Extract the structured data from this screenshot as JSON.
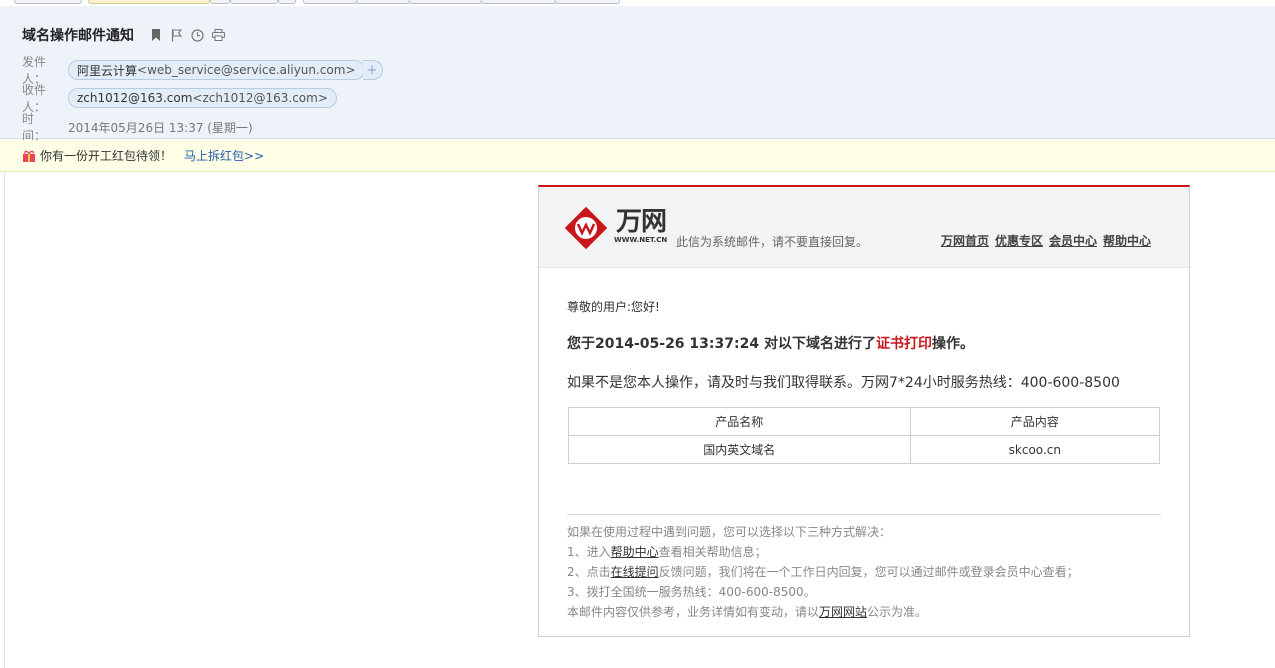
{
  "email": {
    "subject": "域名操作邮件通知",
    "from_label": "发件人：",
    "from_name": "阿里云计算",
    "from_addr": "<web_service@service.aliyun.com>",
    "add_contact": "+",
    "to_label": "收件人：",
    "to_name": "zch1012@163.com",
    "to_addr": "<zch1012@163.com>",
    "time_label": "时　间：",
    "time_value": "2014年05月26日 13:37 (星期一)"
  },
  "toolbar_icons": [
    "bookmark-icon",
    "flag-icon",
    "clock-icon",
    "print-icon"
  ],
  "notice": {
    "text": "你有一份开工红包待领！",
    "link": "马上拆红包>>"
  },
  "content": {
    "logo_cn": "万网",
    "logo_en": "WWW.NET.CN",
    "head_note": "此信为系统邮件，请不要直接回复。",
    "nav_links": [
      "万网首页",
      "优惠专区",
      "会员中心",
      "帮助中心"
    ],
    "greeting": "尊敬的用户:您好!",
    "op_prefix": "您于2014-05-26 13:37:24 对以下域名进行了",
    "op_action": "证书打印",
    "op_suffix": "操作。",
    "hotline": "如果不是您本人操作，请及时与我们取得联系。万网7*24小时服务热线：400-600-8500",
    "table": {
      "headers": [
        "产品名称",
        "产品内容"
      ],
      "rows": [
        [
          "国内英文域名",
          "skcoo.cn"
        ]
      ]
    },
    "help": {
      "intro": "如果在使用过程中遇到问题，您可以选择以下三种方式解决：",
      "l1_pre": "1、进入",
      "l1_link": "帮助中心",
      "l1_post": "查看相关帮助信息；",
      "l2_pre": "2、点击",
      "l2_link": "在线提问",
      "l2_post": "反馈问题，我们将在一个工作日内回复，您可以通过邮件或登录会员中心查看；",
      "l3": "3、拨打全国统一服务热线：400-600-8500。",
      "l4_pre": "本邮件内容仅供参考，业务详情如有变动，请以",
      "l4_link": "万网网站",
      "l4_post": "公示为准。"
    }
  },
  "colors": {
    "header_bg": "#eef3fa",
    "notice_bg": "#fefde5",
    "accent_red": "#c8161d",
    "link_blue": "#1f5fb0"
  }
}
